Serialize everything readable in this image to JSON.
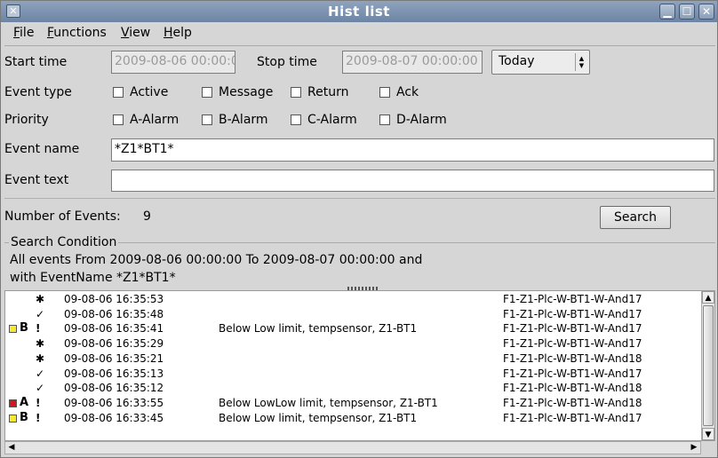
{
  "window": {
    "title": "Hist list"
  },
  "menu": [
    {
      "label": "File",
      "accel": "F",
      "rest": "ile"
    },
    {
      "label": "Functions",
      "accel": "F",
      "rest": "unctions"
    },
    {
      "label": "View",
      "accel": "V",
      "rest": "iew"
    },
    {
      "label": "Help",
      "accel": "H",
      "rest": "elp"
    }
  ],
  "form": {
    "start_label": "Start time",
    "start_value": "2009-08-06 00:00:0",
    "stop_label": "Stop time",
    "stop_value": "2009-08-07 00:00:00",
    "period_value": "Today",
    "event_type_label": "Event type",
    "event_types": [
      "Active",
      "Message",
      "Return",
      "Ack"
    ],
    "priority_label": "Priority",
    "priorities": [
      "A-Alarm",
      "B-Alarm",
      "C-Alarm",
      "D-Alarm"
    ],
    "event_name_label": "Event name",
    "event_name_value": "*Z1*BT1*",
    "event_text_label": "Event text",
    "event_text_value": "",
    "num_events_label": "Number of Events:",
    "num_events_value": "9",
    "search_label": "Search"
  },
  "search_condition": {
    "title": "Search Condition",
    "line1": "All events From 2009-08-06 00:00:00 To 2009-08-07 00:00:00 and",
    "line2": "with EventName *Z1*BT1*"
  },
  "colors": {
    "yellow": "#f5e92a",
    "red": "#d8131b"
  },
  "events": [
    {
      "icon": "✱",
      "time": "09-08-06 16:35:53",
      "text": "",
      "name": "F1-Z1-Plc-W-BT1-W-And17"
    },
    {
      "icon": "✓",
      "time": "09-08-06 16:35:48",
      "text": "",
      "name": "F1-Z1-Plc-W-BT1-W-And17"
    },
    {
      "prio": "B",
      "sq": "yellow",
      "icon": "!",
      "time": "09-08-06 16:35:41",
      "text": "Below Low limit, tempsensor, Z1-BT1",
      "name": "F1-Z1-Plc-W-BT1-W-And17"
    },
    {
      "icon": "✱",
      "time": "09-08-06 16:35:29",
      "text": "",
      "name": "F1-Z1-Plc-W-BT1-W-And17"
    },
    {
      "icon": "✱",
      "time": "09-08-06 16:35:21",
      "text": "",
      "name": "F1-Z1-Plc-W-BT1-W-And18"
    },
    {
      "icon": "✓",
      "time": "09-08-06 16:35:13",
      "text": "",
      "name": "F1-Z1-Plc-W-BT1-W-And17"
    },
    {
      "icon": "✓",
      "time": "09-08-06 16:35:12",
      "text": "",
      "name": "F1-Z1-Plc-W-BT1-W-And18"
    },
    {
      "prio": "A",
      "sq": "red",
      "icon": "!",
      "time": "09-08-06 16:33:55",
      "text": "Below LowLow limit, tempsensor, Z1-BT1",
      "name": "F1-Z1-Plc-W-BT1-W-And18"
    },
    {
      "prio": "B",
      "sq": "yellow",
      "icon": "!",
      "time": "09-08-06 16:33:45",
      "text": "Below Low limit, tempsensor, Z1-BT1",
      "name": "F1-Z1-Plc-W-BT1-W-And17"
    }
  ]
}
